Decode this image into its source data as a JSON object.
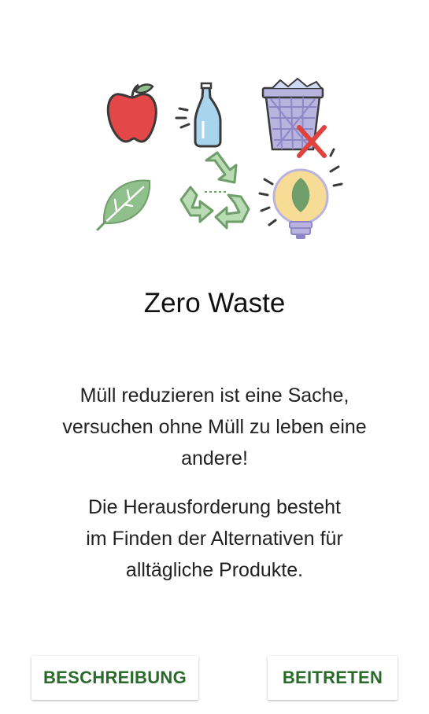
{
  "title": "Zero Waste",
  "description": {
    "line1": "Müll reduzieren ist eine Sache,",
    "line2": "versuchen ohne Müll zu leben eine",
    "line3": "andere!",
    "line4": "Die Herausforderung besteht",
    "line5": "im Finden der Alternativen für",
    "line6": "alltägliche Produkte."
  },
  "buttons": {
    "left": "BESCHREIBUNG",
    "right": "BEITRETEN"
  },
  "colors": {
    "accent_text": "#2a6a2a",
    "icon_green": "#8fbf8a",
    "icon_purple": "#9a92c8",
    "icon_red": "#e0433d"
  }
}
